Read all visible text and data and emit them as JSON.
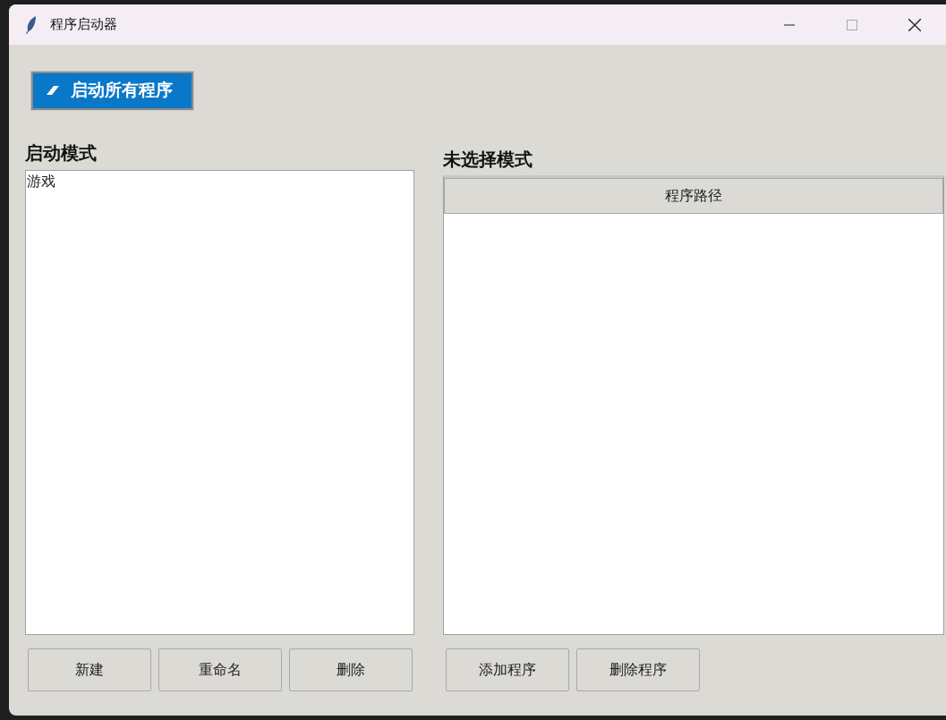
{
  "window": {
    "title": "程序启动器"
  },
  "launch_button": {
    "label": "启动所有程序"
  },
  "modes": {
    "heading": "启动模式",
    "items": [
      {
        "label": "游戏",
        "selected": false
      }
    ],
    "buttons": [
      "新建",
      "重命名",
      "删除"
    ]
  },
  "programs": {
    "heading": "未选择模式",
    "columns": [
      "程序路径"
    ],
    "buttons": [
      "添加程序",
      "删除程序"
    ]
  }
}
